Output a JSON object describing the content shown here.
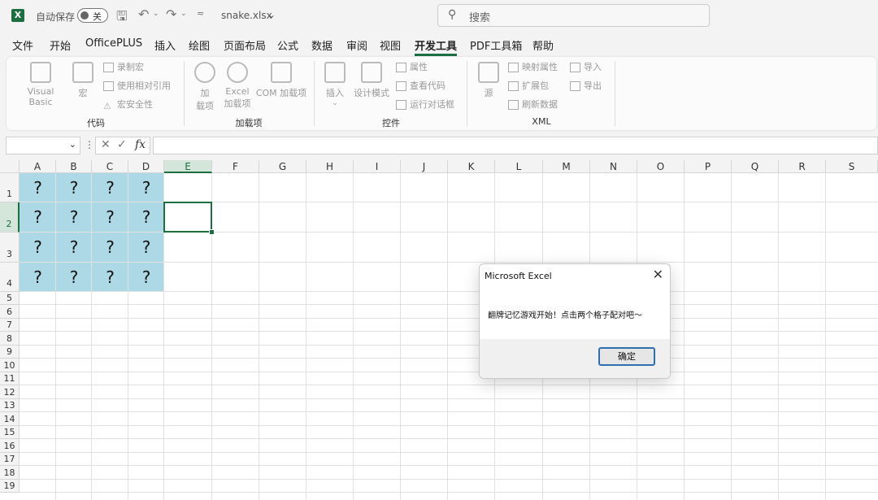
{
  "titlebar": {
    "autosave_label": "自动保存",
    "autosave_state": "关",
    "filename": "snake.xlsx",
    "search_placeholder": "搜索"
  },
  "menu": [
    "文件",
    "开始",
    "OfficePLUS",
    "插入",
    "绘图",
    "页面布局",
    "公式",
    "数据",
    "审阅",
    "视图",
    "开发工具",
    "PDF工具箱",
    "帮助"
  ],
  "menu_active_index": 10,
  "ribbon": {
    "code": {
      "label": "代码",
      "visual_basic": "Visual Basic",
      "macro": "宏",
      "record_macro": "录制宏",
      "relative_ref": "使用相对引用",
      "macro_security": "宏安全性"
    },
    "addins": {
      "label": "加载项",
      "addin_line1": "加",
      "addin_line2": "载项",
      "excel_line1": "Excel",
      "excel_line2": "加载项",
      "com_addin": "COM 加载项"
    },
    "controls": {
      "label": "控件",
      "insert": "插入",
      "design_mode": "设计模式",
      "properties": "属性",
      "view_code": "查看代码",
      "run_dialog": "运行对话框"
    },
    "xml": {
      "label": "XML",
      "source": "源",
      "map_props": "映射属性",
      "expansion": "扩展包",
      "refresh": "刷新数据",
      "import": "导入",
      "export": "导出"
    }
  },
  "formula_bar": {
    "fx": "fx",
    "value": ""
  },
  "columns": [
    "A",
    "B",
    "C",
    "D",
    "E",
    "F",
    "G",
    "H",
    "I",
    "J",
    "K",
    "L",
    "M",
    "N",
    "O",
    "P",
    "Q",
    "R",
    "S"
  ],
  "rows": [
    "1",
    "2",
    "3",
    "4",
    "5",
    "6",
    "7",
    "8",
    "9",
    "10",
    "11",
    "12",
    "13",
    "14",
    "15",
    "16",
    "17",
    "18",
    "19"
  ],
  "cells": {
    "r1": [
      "?",
      "?",
      "?",
      "?"
    ],
    "r2": [
      "?",
      "?",
      "?",
      "?"
    ],
    "r3": [
      "?",
      "?",
      "?",
      "?"
    ],
    "r4": [
      "?",
      "?",
      "?",
      "?"
    ]
  },
  "colors": {
    "excel_green": "#1d6f42",
    "card_blue": "#add8e6"
  },
  "dialog": {
    "title": "Microsoft Excel",
    "message": "翻牌记忆游戏开始！点击两个格子配对吧～",
    "ok": "确定"
  }
}
